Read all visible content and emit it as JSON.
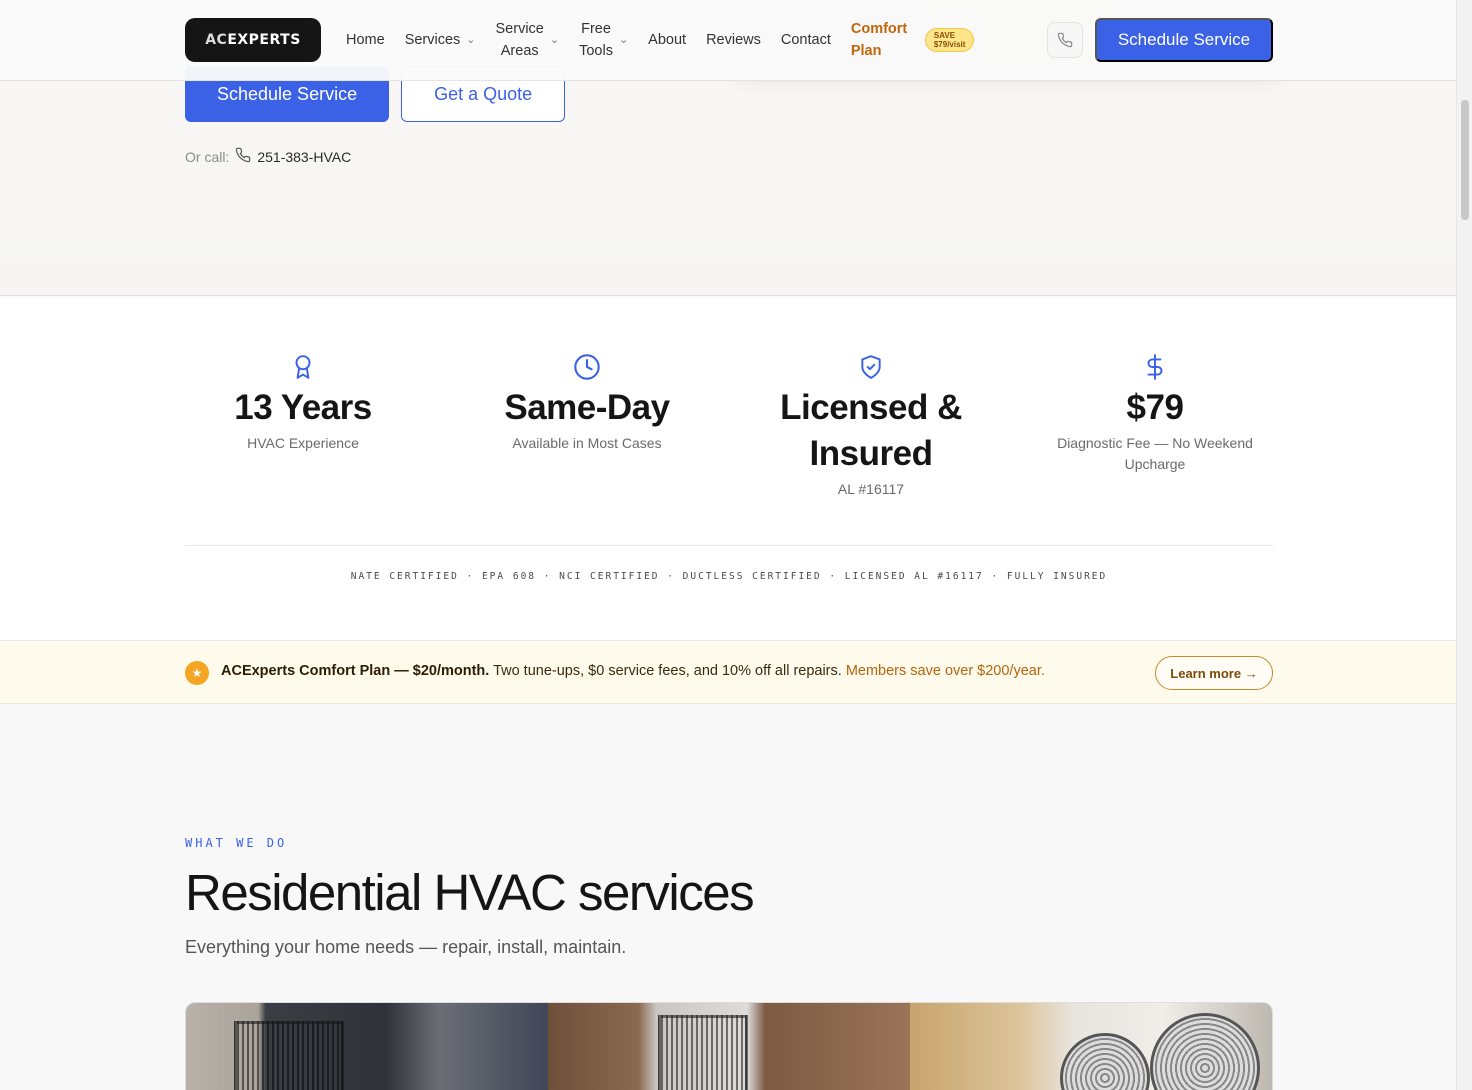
{
  "header": {
    "logo_ac": "AC",
    "logo_rest": "EXPERTS",
    "nav": [
      {
        "label": "Home",
        "has_dropdown": false
      },
      {
        "label": "Services",
        "has_dropdown": true
      },
      {
        "label": "Service\nAreas",
        "has_dropdown": true
      },
      {
        "label": "Free\nTools",
        "has_dropdown": true
      },
      {
        "label": "About",
        "has_dropdown": false
      },
      {
        "label": "Reviews",
        "has_dropdown": false
      },
      {
        "label": "Contact",
        "has_dropdown": false
      }
    ],
    "comfort_label": "Comfort Plan",
    "save_badge_line1": "SAVE",
    "save_badge_line2": "$79/visit",
    "cta": "Schedule Service"
  },
  "hero": {
    "primary_cta": "Schedule Service",
    "secondary_cta": "Get a Quote",
    "call_label": "Or call:",
    "call_number": "251-383-HVAC"
  },
  "stats": [
    {
      "icon": "award-icon",
      "value": "13 Years",
      "caption": "HVAC Experience"
    },
    {
      "icon": "clock-icon",
      "value": "Same-Day",
      "caption": "Available in Most Cases"
    },
    {
      "icon": "shield-check-icon",
      "value": "Licensed & Insured",
      "caption": "AL #16117"
    },
    {
      "icon": "dollar-icon",
      "value": "$79",
      "caption": "Diagnostic Fee — No Weekend Upcharge"
    }
  ],
  "certifications": "NATE CERTIFIED · EPA 608 · NCI CERTIFIED · DUCTLESS CERTIFIED · LICENSED AL #16117 · FULLY INSURED",
  "banner": {
    "bold": "ACExperts Comfort Plan — $20/month.",
    "body": " Two tune-ups, $0 service fees, and 10% off all repairs. ",
    "savings": "Members save over $200/year.",
    "learn_more": "Learn more →"
  },
  "services": {
    "eyebrow": "WHAT WE DO",
    "heading": "Residential HVAC services",
    "subheading": "Everything your home needs — repair, install, maintain."
  },
  "colors": {
    "accent": "#3b62e6",
    "comfort": "#c2650b",
    "banner_bg": "#fefaec"
  }
}
